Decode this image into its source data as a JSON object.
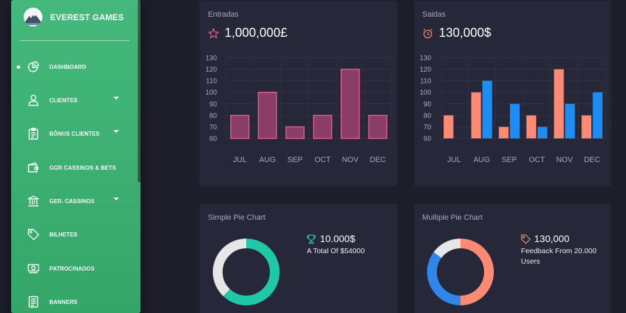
{
  "sidebar": {
    "brand": "EVEREST GAMES",
    "items": [
      {
        "label": "DASHBOARD",
        "icon": "pie-chart-icon",
        "active": true,
        "caret": false
      },
      {
        "label": "CLIENTES",
        "icon": "user-icon",
        "active": false,
        "caret": true
      },
      {
        "label": "BÔNUS CLIENTES",
        "icon": "clipboard-icon",
        "active": false,
        "caret": true
      },
      {
        "label": "GGR CASSINOS & BETS",
        "icon": "wallet-icon",
        "active": false,
        "caret": false
      },
      {
        "label": "GER. CASSINOS",
        "icon": "bank-icon",
        "active": false,
        "caret": true
      },
      {
        "label": "BILHETES",
        "icon": "tag-icon",
        "active": false,
        "caret": false
      },
      {
        "label": "PATROCINADOS",
        "icon": "money-icon",
        "active": false,
        "caret": false
      },
      {
        "label": "BANNERS",
        "icon": "document-icon",
        "active": false,
        "caret": false
      }
    ]
  },
  "cards": {
    "entradas": {
      "title": "Entradas",
      "value": "1,000,000£",
      "icon": "star-icon",
      "icon_color": "#e05a8c"
    },
    "saidas": {
      "title": "Saidas",
      "value": "130,000$",
      "icon": "alarm-clock-icon",
      "icon_color": "#f08a6e"
    },
    "simple_pie": {
      "title": "Simple Pie Chart",
      "value": "10.000$",
      "sub": "A Total Of $54000",
      "icon": "trophy-icon",
      "icon_color": "#1fc8a6"
    },
    "multiple_pie": {
      "title": "Multiple Pie Chart",
      "value": "130,000",
      "sub1": "Feedback From 20.000",
      "sub2": "Users",
      "icon": "tag-icon",
      "icon_color": "#f08a6e"
    }
  },
  "chart_data": [
    {
      "type": "bar",
      "categories": [
        "JUL",
        "AUG",
        "SEP",
        "OCT",
        "NOV",
        "DEC"
      ],
      "series": [
        {
          "values": [
            80,
            100,
            70,
            80,
            120,
            80
          ],
          "color": "#e05a8c"
        }
      ],
      "ylim": [
        60,
        130
      ],
      "yticks": [
        60,
        70,
        80,
        90,
        100,
        110,
        120,
        130
      ],
      "grid": true
    },
    {
      "type": "bar",
      "categories": [
        "JUL",
        "AUG",
        "SEP",
        "OCT",
        "NOV",
        "DEC"
      ],
      "series": [
        {
          "values": [
            80,
            100,
            70,
            80,
            120,
            80
          ],
          "color": "#ff8a73"
        },
        {
          "values": [
            null,
            110,
            90,
            70,
            90,
            100
          ],
          "color": "#1e8cf5"
        }
      ],
      "ylim": [
        60,
        130
      ],
      "yticks": [
        60,
        70,
        80,
        90,
        100,
        110,
        120,
        130
      ],
      "grid": true
    },
    {
      "type": "pie",
      "slices": [
        {
          "value": 62,
          "color": "#1fc8a6"
        },
        {
          "value": 38,
          "color": "#e6e6e6"
        }
      ]
    },
    {
      "type": "pie",
      "slices": [
        {
          "value": 50,
          "color": "#ff8a73"
        },
        {
          "value": 35,
          "color": "#2f86e8"
        },
        {
          "value": 15,
          "color": "#e6e6e6"
        }
      ]
    }
  ]
}
